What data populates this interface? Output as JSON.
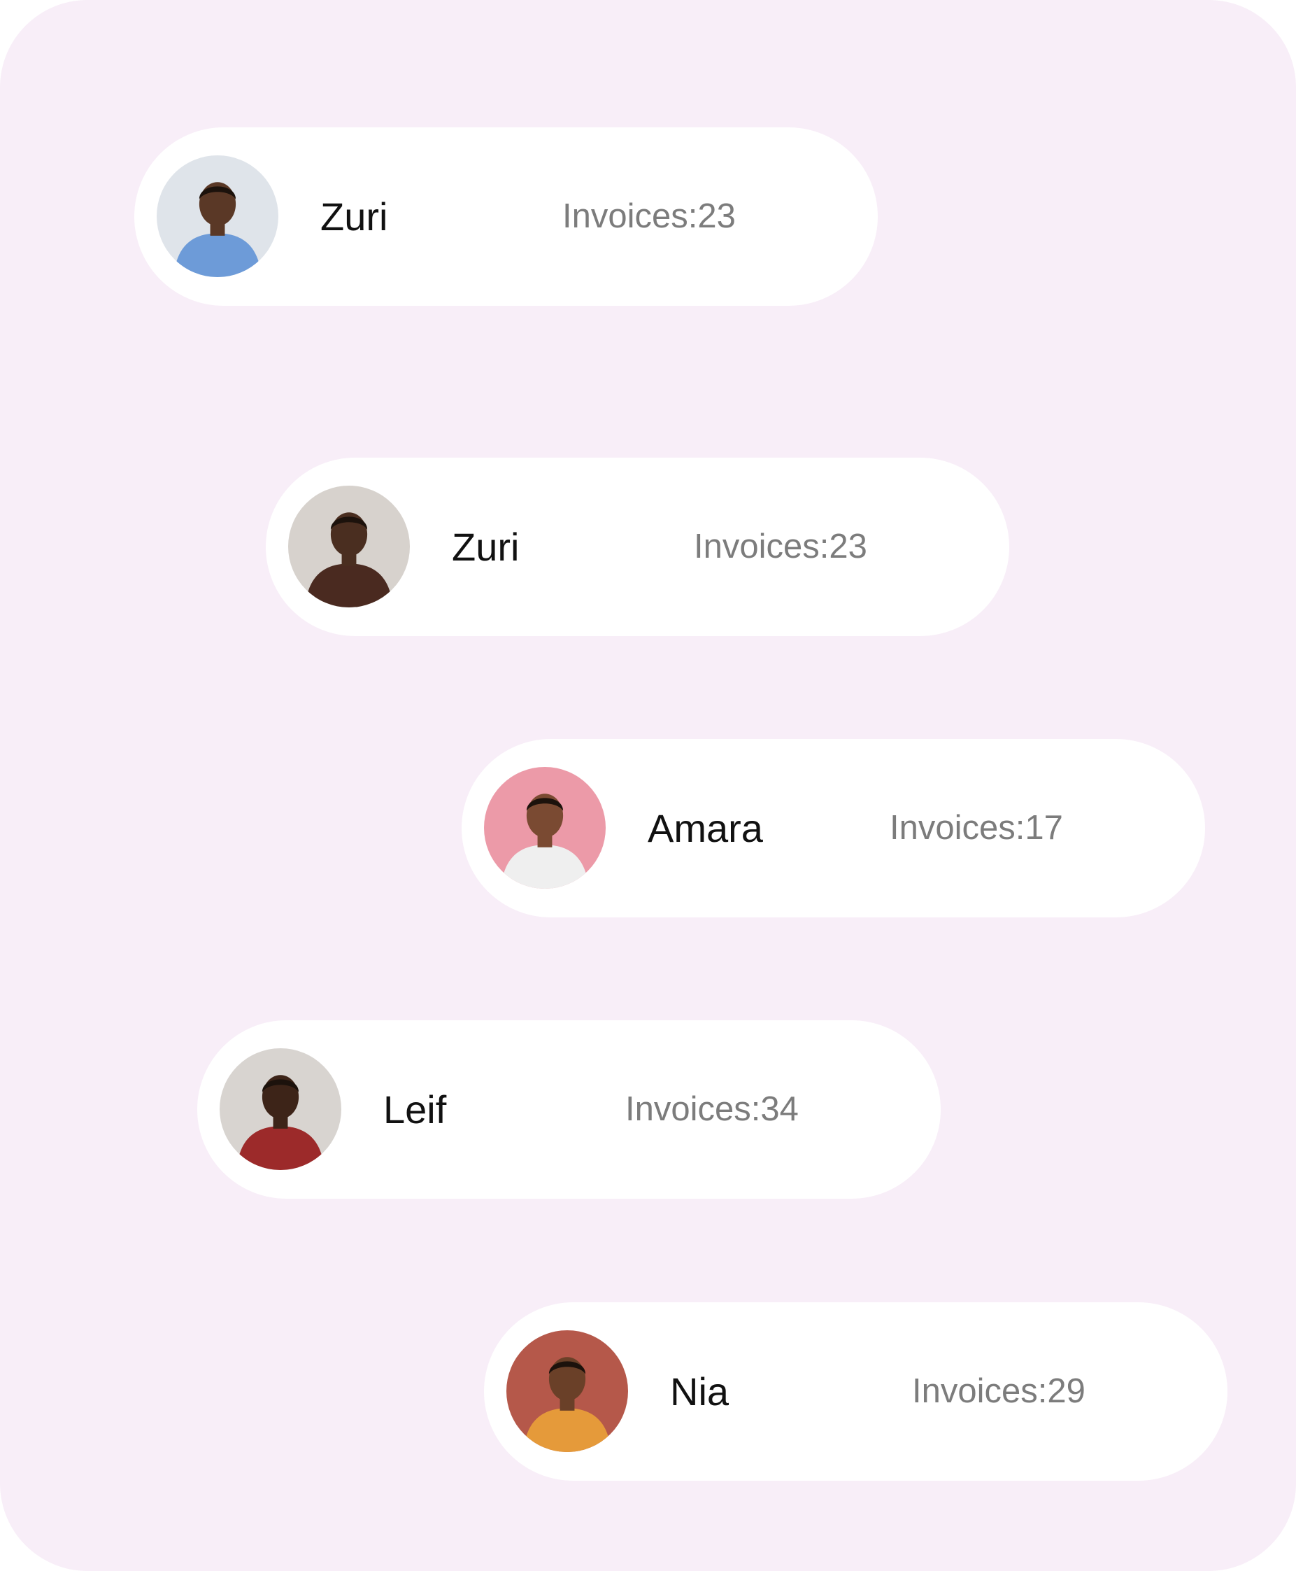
{
  "customers": [
    {
      "name": "Zuri",
      "invoices_label": "Invoices:23",
      "avatar_icon": "person-photo-man-blue-shirt",
      "avatar_bg": "#dfe4ea",
      "avatar_skin": "#5a3826",
      "avatar_cloth": "#6d9bd8"
    },
    {
      "name": "Zuri",
      "invoices_label": "Invoices:23",
      "avatar_icon": "person-photo-woman-brown-blazer",
      "avatar_bg": "#d7d2cd",
      "avatar_skin": "#4a2e20",
      "avatar_cloth": "#4a2a20"
    },
    {
      "name": "Amara",
      "invoices_label": "Invoices:17",
      "avatar_icon": "person-photo-woman-white-tee",
      "avatar_bg": "#ec9aa8",
      "avatar_skin": "#7a4a32",
      "avatar_cloth": "#efefef"
    },
    {
      "name": "Leif",
      "invoices_label": "Invoices:34",
      "avatar_icon": "person-photo-elderly-woman-plaid",
      "avatar_bg": "#d8d4d0",
      "avatar_skin": "#3d2418",
      "avatar_cloth": "#9c2a2a"
    },
    {
      "name": "Nia",
      "invoices_label": "Invoices:29",
      "avatar_icon": "person-photo-elderly-man-patterned-shirt",
      "avatar_bg": "#b5584a",
      "avatar_skin": "#6a4028",
      "avatar_cloth": "#e59a3a"
    }
  ]
}
